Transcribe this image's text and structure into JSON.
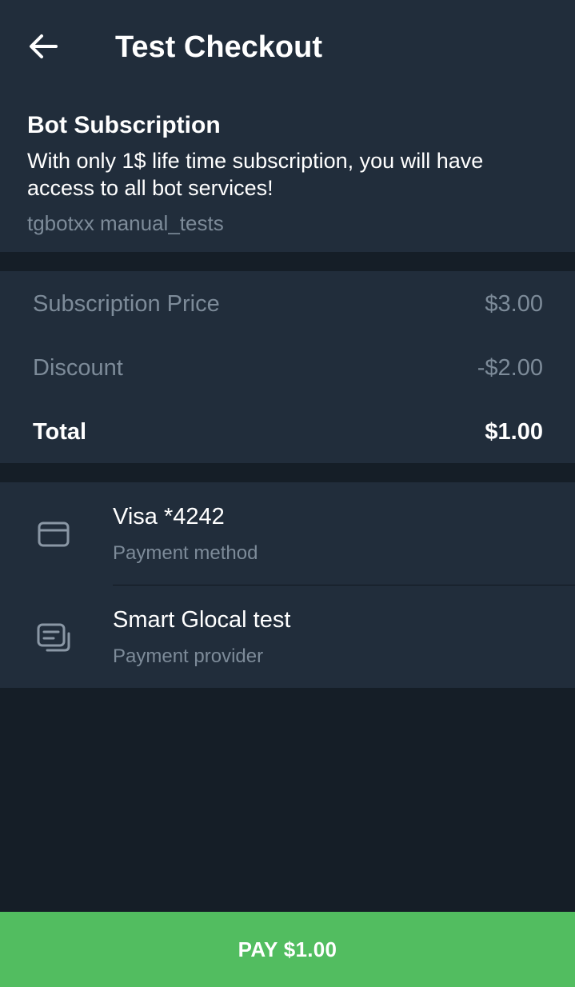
{
  "header": {
    "title": "Test Checkout",
    "back_icon": "arrow-left-icon"
  },
  "product": {
    "name": "Bot Subscription",
    "description": "With only 1$ life time subscription, you will have access to all bot services!",
    "bot": "tgbotxx manual_tests"
  },
  "prices": [
    {
      "label": "Subscription Price",
      "value": "$3.00"
    },
    {
      "label": "Discount",
      "value": "-$2.00"
    },
    {
      "label": "Total",
      "value": "$1.00"
    }
  ],
  "payment": {
    "method": {
      "title": "Visa *4242",
      "subtitle": "Payment method",
      "icon": "credit-card-icon"
    },
    "provider": {
      "title": "Smart Glocal test",
      "subtitle": "Payment provider",
      "icon": "provider-list-icon"
    }
  },
  "pay_button": {
    "label": "PAY $1.00"
  },
  "colors": {
    "background": "#151e27",
    "surface": "#212d3b",
    "secondary_text": "#7d8b99",
    "pay_green": "#52bd60"
  }
}
